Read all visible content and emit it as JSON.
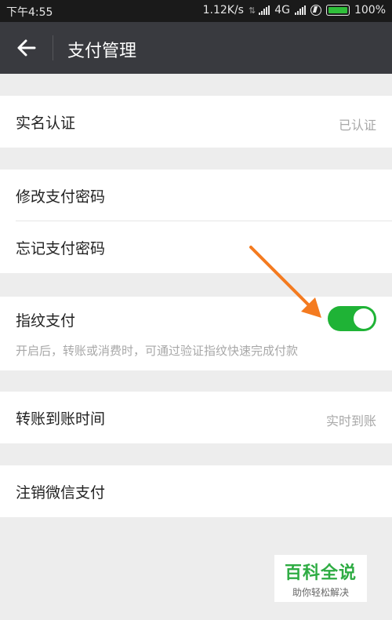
{
  "status_bar": {
    "time": "下午4:55",
    "speed": "1.12K/s",
    "network": "4G",
    "battery": "100%"
  },
  "app_bar": {
    "title": "支付管理",
    "back_icon": "arrow-left-icon"
  },
  "groups": {
    "realname": {
      "label": "实名认证",
      "value": "已认证"
    },
    "password": {
      "change_label": "修改支付密码",
      "forgot_label": "忘记支付密码"
    },
    "fingerprint": {
      "label": "指纹支付",
      "enabled": true,
      "description": "开启后，转账或消费时，可通过验证指纹快速完成付款"
    },
    "transfer_time": {
      "label": "转账到账时间",
      "value": "实时到账"
    },
    "deactivate": {
      "label": "注销微信支付"
    }
  },
  "watermark": {
    "main": "百科全说",
    "sub": "助你轻松解决"
  },
  "colors": {
    "app_bar": "#393a3f",
    "toggle_on": "#1fb336",
    "annotation_arrow": "#f47b20",
    "background": "#ededed"
  }
}
